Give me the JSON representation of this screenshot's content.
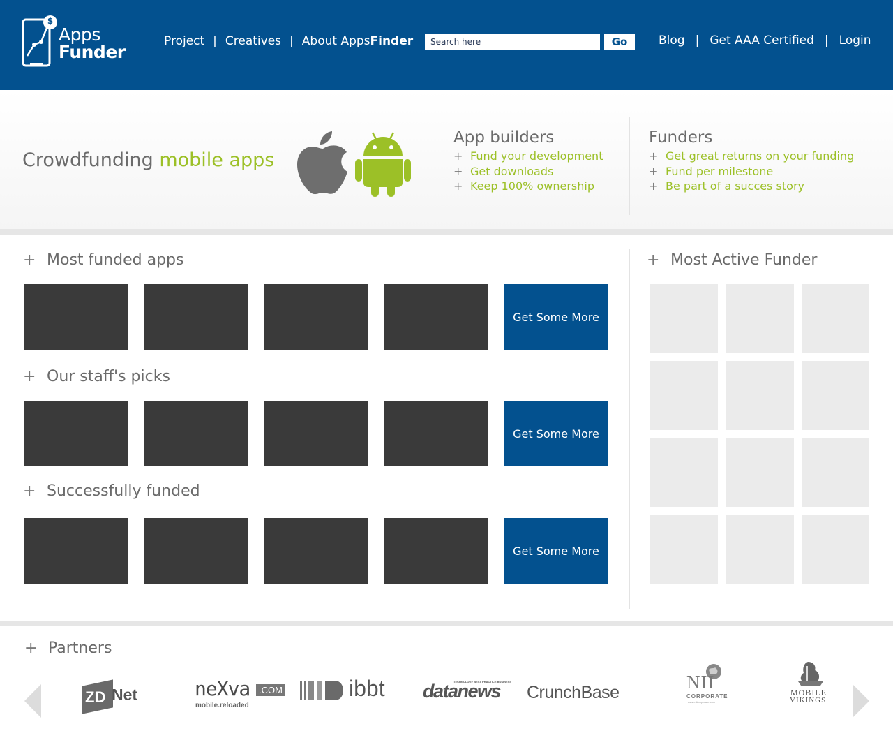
{
  "header": {
    "logo": {
      "line1": "Apps",
      "line2": "Funder",
      "badge": "$"
    },
    "nav_left": [
      {
        "label_plain": "Project",
        "label_bold": ""
      },
      {
        "label_plain": "Creatives",
        "label_bold": ""
      },
      {
        "label_plain": "About Apps",
        "label_bold": "Finder"
      }
    ],
    "search": {
      "placeholder": "Search here",
      "value": "",
      "go_label": "Go"
    },
    "nav_right": [
      "Blog",
      "Get AAA Certified",
      "Login"
    ],
    "separator": "|"
  },
  "hero": {
    "title_plain": "Crowdfunding ",
    "title_accent": "mobile apps",
    "platform_icons": [
      "apple-icon",
      "android-icon"
    ],
    "app_builders": {
      "title": "App builders",
      "items": [
        "Fund your development",
        "Get downloads",
        "Keep 100% ownership"
      ]
    },
    "funders": {
      "title": "Funders",
      "items": [
        "Get great returns on your funding",
        "Fund per milestone",
        "Be part of a succes story"
      ]
    },
    "bullet": "+"
  },
  "sections": [
    {
      "title": "Most funded apps",
      "more_label": "Get Some More"
    },
    {
      "title": "Our staff's picks",
      "more_label": "Get Some More"
    },
    {
      "title": "Successfully funded",
      "more_label": "Get Some More"
    }
  ],
  "sidebar": {
    "title": "Most Active Funder"
  },
  "partners": {
    "title": "Partners",
    "logos": {
      "zdnet_a": "ZD",
      "zdnet_b": "Net",
      "nexva_a": "neXva",
      "nexva_b": ".COM",
      "nexva_tag": "mobile.reloaded",
      "ibbt": "ibbt",
      "datanews": "datanews",
      "datanews_tag": "TECHNOLOGY BEST PRACTICE BUSINESS",
      "crunchbase": "CrunchBase",
      "nii_a": "NII",
      "nii_b": "CORPORATE",
      "nii_c": "www.niicorporate.com",
      "mv_a": "MOBILE",
      "mv_b": "VIKINGS"
    }
  },
  "colors": {
    "brand_blue": "#03518f",
    "accent_green": "#9cc027",
    "tile_dark": "#3a3a3a",
    "tile_light": "#ebebeb"
  }
}
